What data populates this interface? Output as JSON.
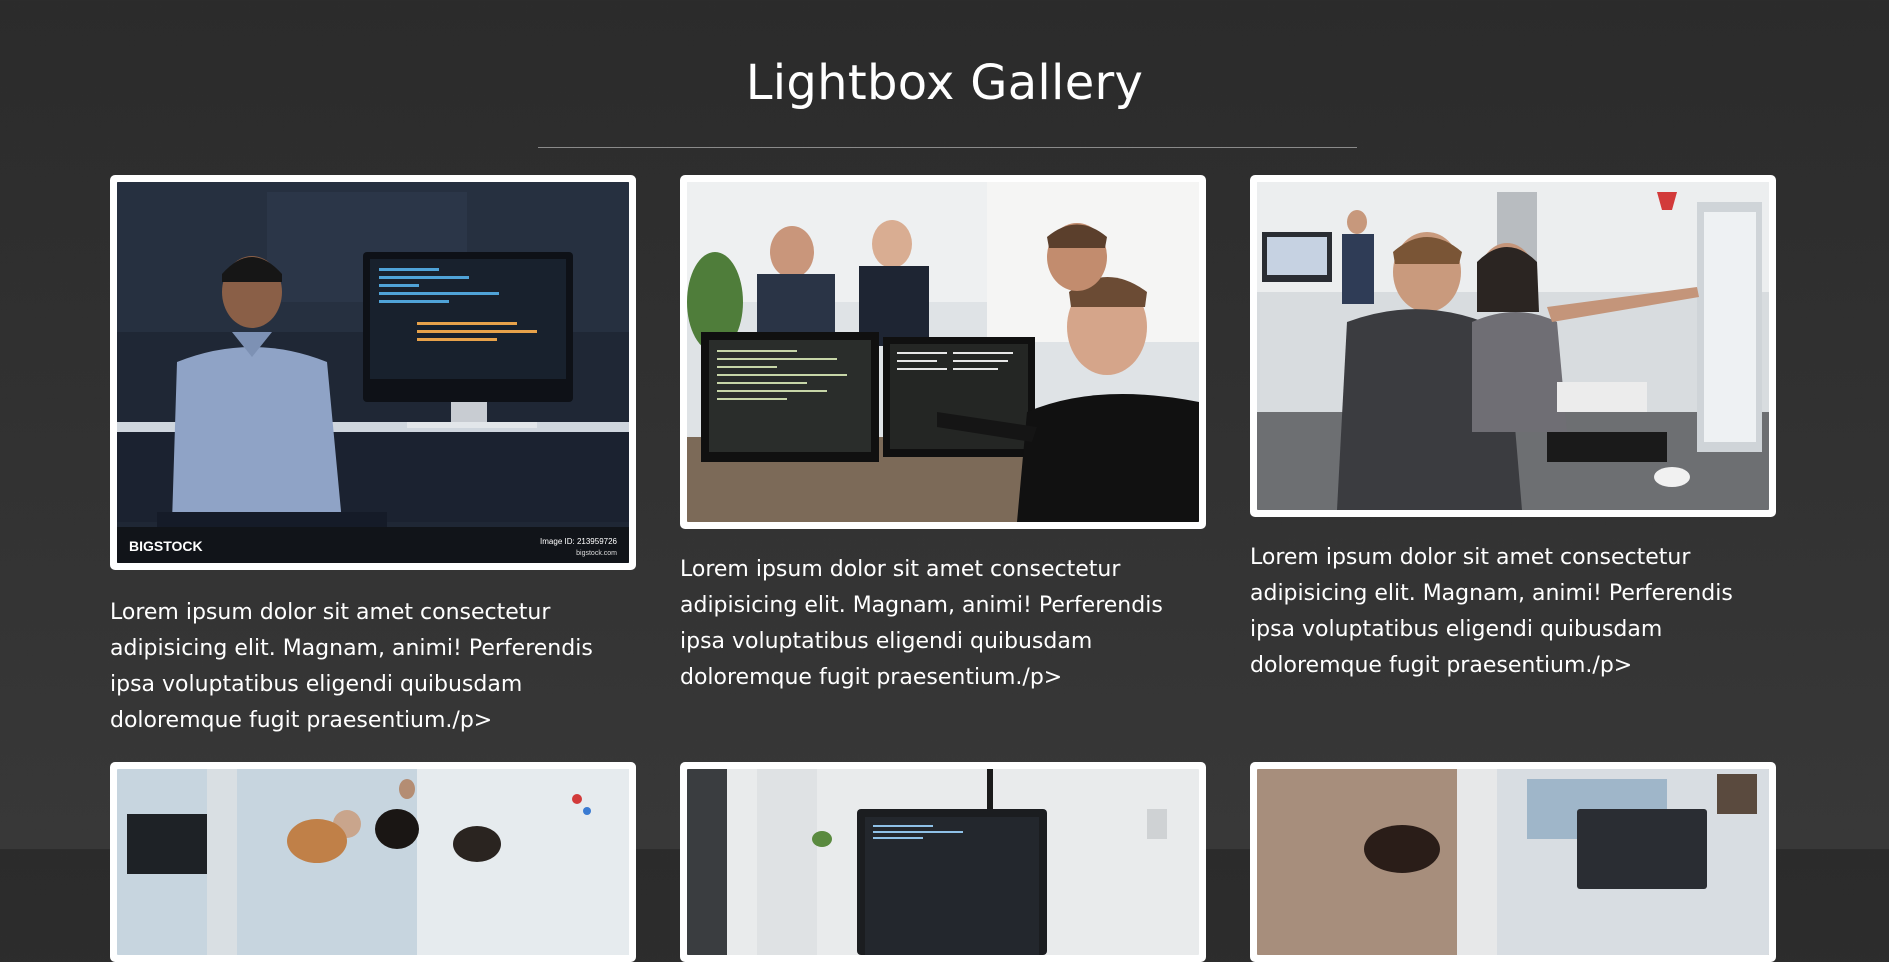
{
  "page": {
    "title": "Lightbox Gallery"
  },
  "gallery": {
    "items": [
      {
        "caption": "Lorem ipsum dolor sit amet consectetur adipisicing elit. Magnam, animi! Perferendis ipsa voluptatibus eligendi quibusdam doloremque fugit praesentium./p>",
        "watermark_brand": "BIGSTOCK",
        "watermark_id": "Image ID: 213959726",
        "watermark_site": "bigstock.com"
      },
      {
        "caption": "Lorem ipsum dolor sit amet consectetur adipisicing elit. Magnam, animi! Perferendis ipsa voluptatibus eligendi quibusdam doloremque fugit praesentium./p>"
      },
      {
        "caption": "Lorem ipsum dolor sit amet consectetur adipisicing elit. Magnam, animi! Perferendis ipsa voluptatibus eligendi quibusdam doloremque fugit praesentium./p>"
      }
    ]
  },
  "colors": {
    "background": "#2e2e2e",
    "text": "#ffffff",
    "divider": "#8a8a8a",
    "frame": "#ffffff"
  }
}
